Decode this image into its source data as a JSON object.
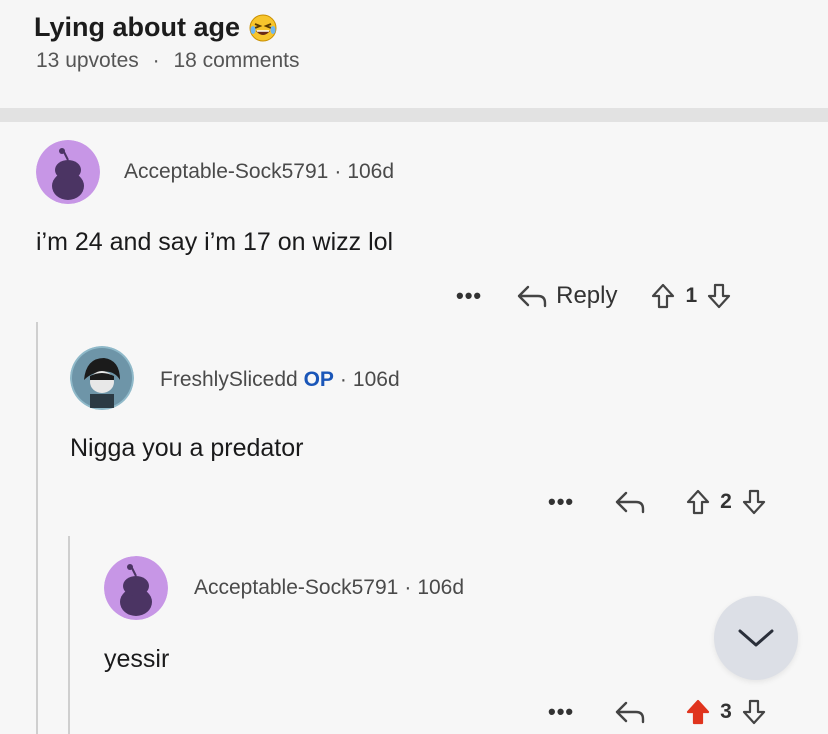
{
  "post": {
    "title": "Lying about age",
    "upvotes": "13 upvotes",
    "dot": "·",
    "comments": "18 comments"
  },
  "comments": [
    {
      "user": "Acceptable-Sock5791",
      "age": "106d",
      "text": "i’m 24 and say i’m 17 on wizz lol",
      "reply_label": "Reply",
      "votes": "1",
      "more": "•••"
    },
    {
      "user": "FreshlySlicedd",
      "op": "OP",
      "age": "106d",
      "text": "Nigga you a predator",
      "votes": "2",
      "more": "•••"
    },
    {
      "user": "Acceptable-Sock5791",
      "age": "106d",
      "text": "yessir",
      "votes": "3",
      "more": "•••"
    }
  ],
  "colors": {
    "avatar_purple": "#c796e6",
    "op_blue": "#1a56b8",
    "upvote_active": "#e0341e"
  }
}
